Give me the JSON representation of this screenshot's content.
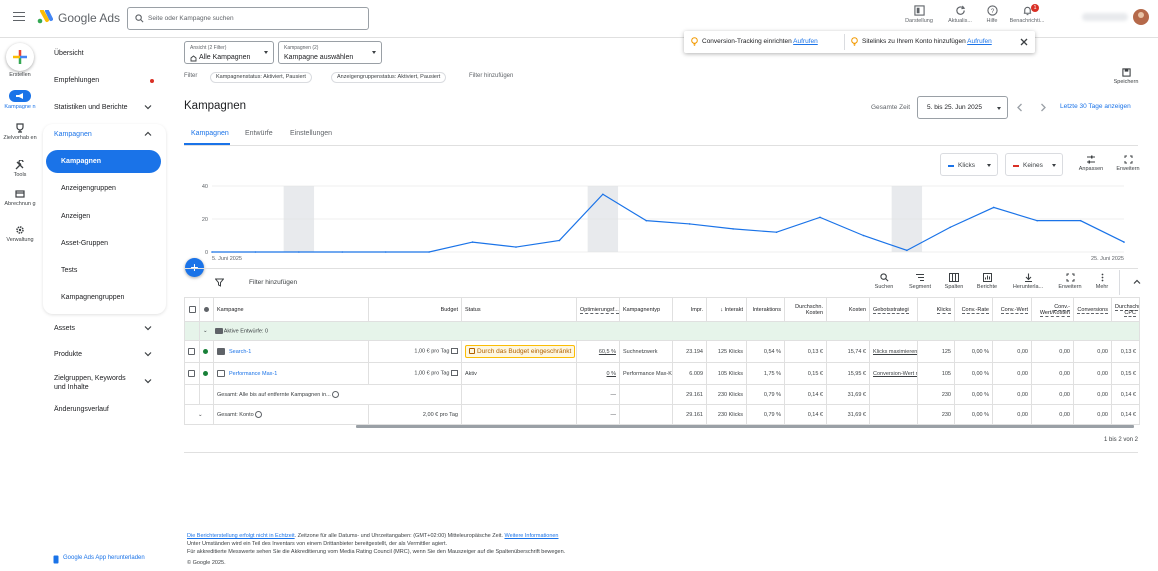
{
  "header": {
    "app_name": "Google Ads",
    "search_placeholder": "Seite oder Kampagne suchen",
    "buttons": [
      {
        "label": "Darstellung",
        "icon": "appearance-icon"
      },
      {
        "label": "Aktualis...",
        "icon": "refresh-icon"
      },
      {
        "label": "Hilfe",
        "icon": "help-icon"
      },
      {
        "label": "Benachrichti...",
        "icon": "bell-icon",
        "badge": "1"
      }
    ]
  },
  "rail": {
    "items": [
      {
        "label": "Erstellen",
        "icon": "plus-icon"
      },
      {
        "label": "Kampagne n",
        "icon": "campaign-icon"
      },
      {
        "label": "Zielvorhab en",
        "icon": "trophy-icon"
      },
      {
        "label": "Tools",
        "icon": "tools-icon"
      },
      {
        "label": "Abrechnun g",
        "icon": "billing-icon"
      },
      {
        "label": "Verwaltung",
        "icon": "admin-gear-icon"
      }
    ]
  },
  "nav": {
    "overview": "Übersicht",
    "recommendations": "Empfehlungen",
    "stats": "Statistiken und Berichte",
    "campaigns_section": "Kampagnen",
    "sub_items": [
      "Kampagnen",
      "Anzeigengruppen",
      "Anzeigen",
      "Asset-Gruppen",
      "Tests",
      "Kampagnengruppen"
    ],
    "assets": "Assets",
    "products": "Produkte",
    "targeting": "Zielgruppen, Keywords und Inhalte",
    "history": "Änderungsverlauf",
    "download_app": "Google Ads App herunterladen"
  },
  "selectors": {
    "view_small": "Ansicht (2 Filter)",
    "view_value": "Alle Kampagnen",
    "campaign_small": "Kampagnen (2)",
    "campaign_value": "Kampagne auswählen"
  },
  "filters": {
    "label": "Filter",
    "chips": [
      "Kampagnenstatus: Aktiviert, Pausiert",
      "Anzeigengruppenstatus: Aktiviert, Pausiert"
    ],
    "add": "Filter hinzufügen"
  },
  "notifications": {
    "item1_text": "Conversion-Tracking einrichten",
    "item1_link": "Aufrufen",
    "item2_text": "Sitelinks zu Ihrem Konto hinzufügen",
    "item2_link": "Aufrufen"
  },
  "save_label": "Speichern",
  "page": {
    "title": "Kampagnen",
    "date_label": "Gesamte Zeit",
    "date_value": "5. bis 25. Jun 2025",
    "last30": "Letzte 30 Tage anzeigen",
    "tabs": [
      "Kampagnen",
      "Entwürfe",
      "Einstellungen"
    ]
  },
  "chart_controls": {
    "metric1": "Klicks",
    "metric1_color": "#1a73e8",
    "metric2": "Keines",
    "metric2_color": "#d93025",
    "adjust": "Anpassen",
    "expand": "Erweitern"
  },
  "chart_data": {
    "type": "line",
    "series": [
      {
        "name": "Klicks",
        "values": [
          0,
          0,
          0,
          0,
          0,
          0,
          6,
          3,
          7,
          35,
          19,
          17,
          14,
          12,
          21,
          10,
          1,
          15,
          27,
          19,
          19,
          6
        ]
      }
    ],
    "x_start_label": "5. Juni 2025",
    "x_end_label": "25. Juni 2025",
    "y_ticks": [
      "40",
      "20",
      "0"
    ],
    "ylim": [
      0,
      40
    ],
    "shaded_weekend_index_ranges": [
      [
        2,
        3
      ],
      [
        9,
        10
      ],
      [
        16,
        17
      ]
    ],
    "color": "#1a73e8"
  },
  "toolbar": {
    "filter_add": "Filter hinzufügen",
    "tools": [
      "Suchen",
      "Segment",
      "Spalten",
      "Berichte",
      "Herunterla...",
      "Erweitern",
      "Mehr"
    ]
  },
  "table": {
    "headers": [
      "",
      "",
      "Kampagne",
      "Budget",
      "Status",
      "Optimierungsf...",
      "Kampagnentyp",
      "Impr.",
      "Interakt",
      "Interaktions",
      "Durchschn. Kosten",
      "Kosten",
      "Gebotsstrategi",
      "Klicks",
      "Conv.-Rate",
      "Conv.-Wert",
      "Conv.-Wert/Kosten",
      "Conversions",
      "Durchschn. CPC"
    ],
    "group_row": "Aktive Entwürfe: 0",
    "rows": [
      {
        "name": "Search-1",
        "budget": "1,00 € pro Tag",
        "status": "Durch das Budget eingeschränkt",
        "opt": "60,5 %",
        "type": "Suchnetzwerk",
        "impr": "23.194",
        "inter": "125 Klicks",
        "rate": "0,54 %",
        "avg": "0,13 €",
        "cost": "15,74 €",
        "bid": "Klicks maximieren",
        "clicks": "125",
        "cvr": "0,00 %",
        "cval": "0,00",
        "cvc": "0,00",
        "conv": "0,00",
        "cpc": "0,13 €"
      },
      {
        "name": "Performance Max-1",
        "budget": "1,00 € pro Tag",
        "status": "Aktiv",
        "opt": "0 %",
        "type": "Performance Max-Kampagne",
        "impr": "6.009",
        "inter": "105 Klicks",
        "rate": "1,75 %",
        "avg": "0,15 €",
        "cost": "15,95 €",
        "bid": "Conversion-Wert maximieren",
        "clicks": "105",
        "cvr": "0,00 %",
        "cval": "0,00",
        "cvc": "0,00",
        "conv": "0,00",
        "cpc": "0,15 €"
      }
    ],
    "total_removed": {
      "label": "Gesamt: Alle bis auf entfernte Kampagnen in...",
      "opt": "—",
      "impr": "29.161",
      "inter": "230 Klicks",
      "rate": "0,79 %",
      "avg": "0,14 €",
      "cost": "31,69 €",
      "clicks": "230",
      "cvr": "0,00 %",
      "cval": "0,00",
      "cvc": "0,00",
      "conv": "0,00",
      "cpc": "0,14 €"
    },
    "total_account": {
      "label": "Gesamt: Konto",
      "budget": "2,00 € pro Tag",
      "opt": "—",
      "impr": "29.161",
      "inter": "230 Klicks",
      "rate": "0,79 %",
      "avg": "0,14 €",
      "cost": "31,69 €",
      "clicks": "230",
      "cvr": "0,00 %",
      "cval": "0,00",
      "cvc": "0,00",
      "conv": "0,00",
      "cpc": "0,14 €"
    },
    "pagination": "1 bis 2 von 2"
  },
  "footer": {
    "line1_link1": "Die Berichterstellung erfolgt nicht in Echtzeit",
    "line1_text": ". Zeitzone für alle Datums- und Uhrzeitangaben: (GMT+02:00) Mitteleuropäische Zeit.",
    "line1_link2": "Weitere Informationen",
    "line2": "Unter Umständen wird ein Teil des Inventars von einem Drittanbieter bereitgestellt, der als Vermittler agiert.",
    "line3": "Für akkreditierte Messwerte sehen Sie die Akkreditierung vom Media Rating Council (MRC), wenn Sie den Mauszeiger auf die Spaltenüberschrift bewegen.",
    "copyright": "© Google 2025."
  }
}
